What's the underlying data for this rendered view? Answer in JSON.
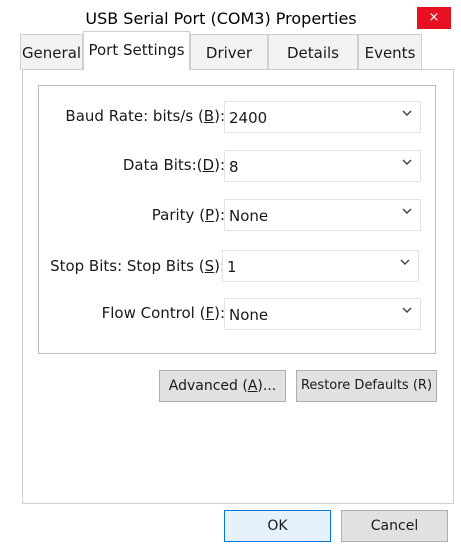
{
  "window": {
    "title": "USB Serial Port (COM3) Properties",
    "close_symbol": "×"
  },
  "tabs": [
    {
      "label": "General"
    },
    {
      "label": "Port Settings"
    },
    {
      "label": "Driver"
    },
    {
      "label": "Details"
    },
    {
      "label": "Events"
    }
  ],
  "fields": [
    {
      "pre": "Baud Rate: bits/s (",
      "key": "B",
      "post": "):",
      "value": "2400"
    },
    {
      "pre": "Data Bits:(",
      "key": "D",
      "post": "):",
      "value": "8"
    },
    {
      "pre": "Parity (",
      "key": "P",
      "post": "):",
      "value": "None"
    },
    {
      "pre": "Stop Bits: Stop Bits (",
      "key": "S",
      "post": "):",
      "value": "1"
    },
    {
      "pre": "Flow Control (",
      "key": "F",
      "post": "):",
      "value": "None"
    }
  ],
  "buttons": {
    "advanced": {
      "pre": "Advanced (",
      "key": "A",
      "post": ")..."
    },
    "restore": "Restore Defaults (R)",
    "ok": "OK",
    "cancel": "Cancel"
  },
  "colors": {
    "close_bg": "#e81123",
    "default_button_border": "#0078d7"
  },
  "icons": {
    "dropdown": "chevron-down-icon"
  }
}
